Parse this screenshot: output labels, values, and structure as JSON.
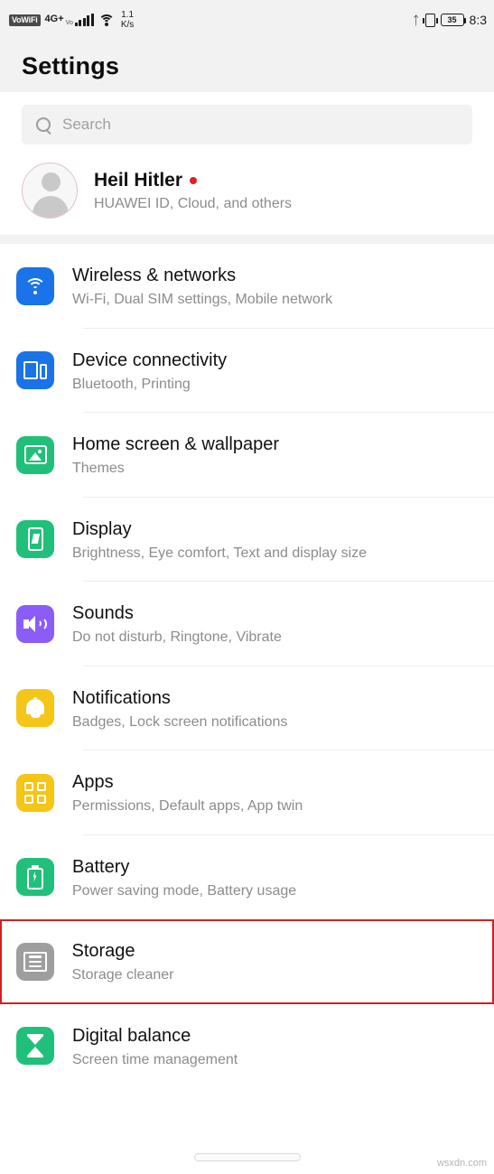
{
  "status_bar": {
    "volte_label": "VoWiFi",
    "network_label": "4G+",
    "network_sub": "Vo",
    "speed_value": "1.1",
    "speed_unit": "K/s",
    "bluetooth_icon": "bluetooth-icon",
    "vibrate_icon": "vibrate-icon",
    "battery_percent": "35",
    "clock": "8:3"
  },
  "header": {
    "title": "Settings"
  },
  "search": {
    "placeholder": "Search",
    "icon": "search-icon"
  },
  "account": {
    "name": "Heil Hitler",
    "subtitle": "HUAWEI ID, Cloud, and others",
    "has_badge": true
  },
  "settings_items": [
    {
      "title": "Wireless & networks",
      "subtitle": "Wi-Fi, Dual SIM settings, Mobile network",
      "icon": "wifi-icon",
      "icon_color": "#1a73e8",
      "highlighted": false
    },
    {
      "title": "Device connectivity",
      "subtitle": "Bluetooth, Printing",
      "icon": "device-connectivity-icon",
      "icon_color": "#1a73e8",
      "highlighted": false
    },
    {
      "title": "Home screen & wallpaper",
      "subtitle": "Themes",
      "icon": "wallpaper-image-icon",
      "icon_color": "#21c07a",
      "highlighted": false
    },
    {
      "title": "Display",
      "subtitle": "Brightness, Eye comfort, Text and display size",
      "icon": "display-icon",
      "icon_color": "#21c07a",
      "highlighted": false
    },
    {
      "title": "Sounds",
      "subtitle": "Do not disturb, Ringtone, Vibrate",
      "icon": "speaker-icon",
      "icon_color": "#8b5cf6",
      "highlighted": false
    },
    {
      "title": "Notifications",
      "subtitle": "Badges, Lock screen notifications",
      "icon": "bell-icon",
      "icon_color": "#f5c518",
      "highlighted": false
    },
    {
      "title": "Apps",
      "subtitle": "Permissions, Default apps, App twin",
      "icon": "apps-grid-icon",
      "icon_color": "#f5c518",
      "highlighted": false
    },
    {
      "title": "Battery",
      "subtitle": "Power saving mode, Battery usage",
      "icon": "battery-icon",
      "icon_color": "#21c07a",
      "highlighted": false
    },
    {
      "title": "Storage",
      "subtitle": "Storage cleaner",
      "icon": "storage-icon",
      "icon_color": "#9e9e9e",
      "highlighted": true
    },
    {
      "title": "Digital balance",
      "subtitle": "Screen time management",
      "icon": "hourglass-icon",
      "icon_color": "#21c07a",
      "highlighted": false
    }
  ],
  "highlight_color": "#d32020",
  "watermark": "wsxdn.com"
}
